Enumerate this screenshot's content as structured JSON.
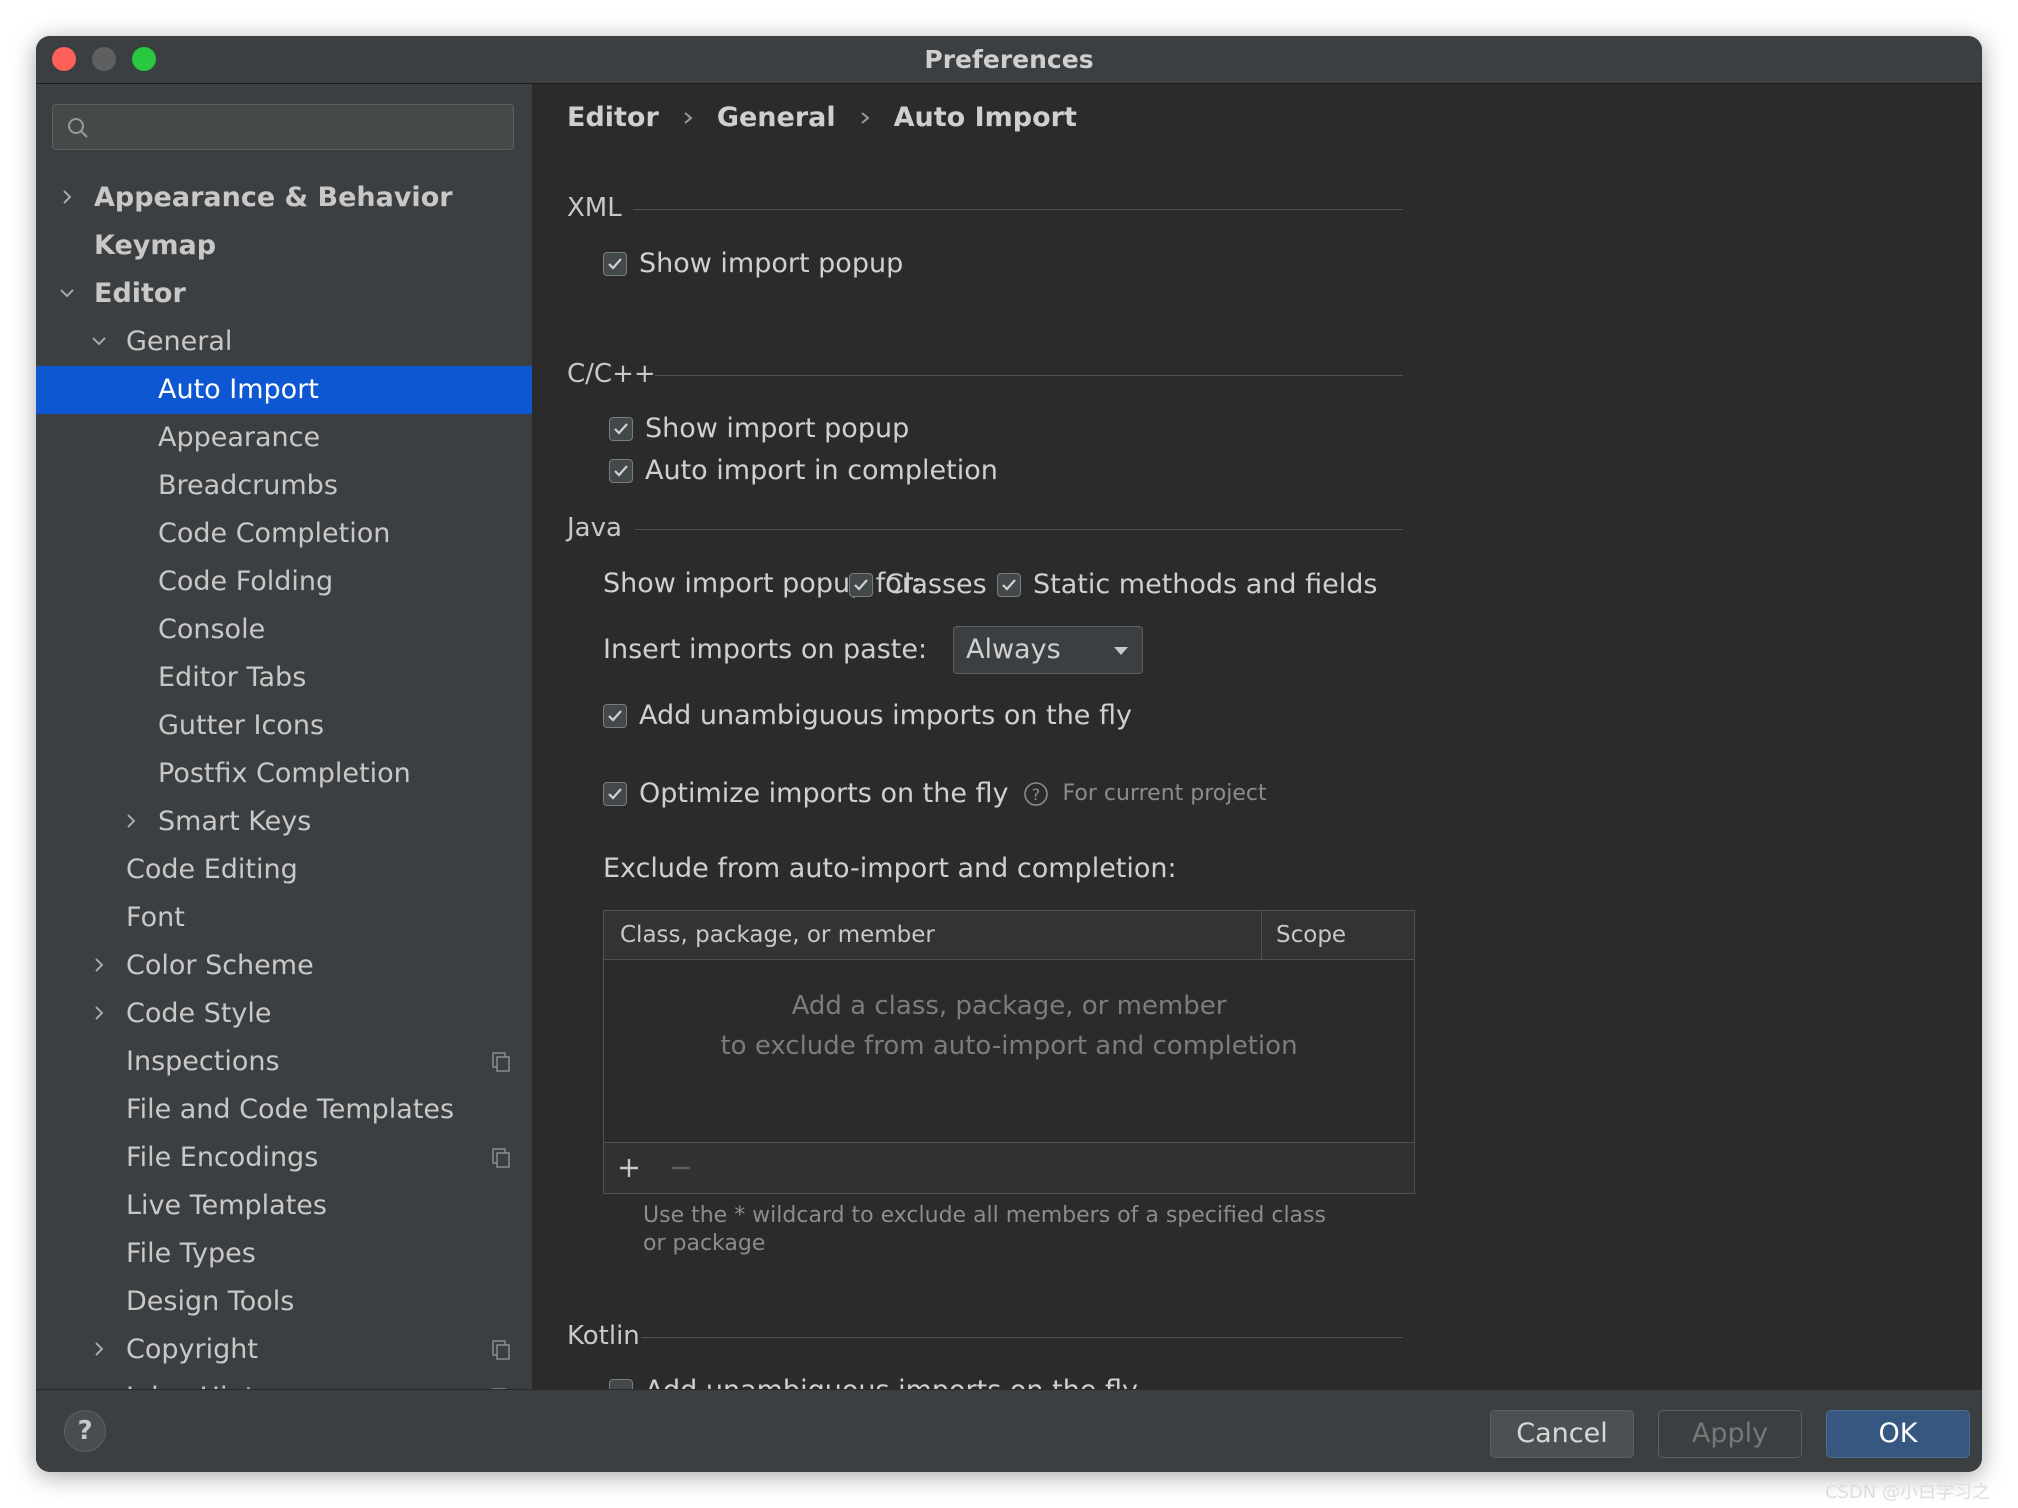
{
  "window": {
    "title": "Preferences"
  },
  "sidebar": {
    "search": {
      "placeholder": "",
      "value": ""
    },
    "items": [
      {
        "label": "Appearance & Behavior",
        "level": 0,
        "bold": true,
        "expandable": true,
        "expanded": false
      },
      {
        "label": "Keymap",
        "level": 0,
        "bold": true
      },
      {
        "label": "Editor",
        "level": 0,
        "bold": true,
        "expandable": true,
        "expanded": true
      },
      {
        "label": "General",
        "level": 1,
        "expandable": true,
        "expanded": true
      },
      {
        "label": "Auto Import",
        "level": 2,
        "selected": true
      },
      {
        "label": "Appearance",
        "level": 2
      },
      {
        "label": "Breadcrumbs",
        "level": 2
      },
      {
        "label": "Code Completion",
        "level": 2
      },
      {
        "label": "Code Folding",
        "level": 2
      },
      {
        "label": "Console",
        "level": 2
      },
      {
        "label": "Editor Tabs",
        "level": 2
      },
      {
        "label": "Gutter Icons",
        "level": 2
      },
      {
        "label": "Postfix Completion",
        "level": 2
      },
      {
        "label": "Smart Keys",
        "level": 2,
        "expandable": true,
        "expanded": false
      },
      {
        "label": "Code Editing",
        "level": 1
      },
      {
        "label": "Font",
        "level": 1
      },
      {
        "label": "Color Scheme",
        "level": 1,
        "expandable": true,
        "expanded": false
      },
      {
        "label": "Code Style",
        "level": 1,
        "expandable": true,
        "expanded": false
      },
      {
        "label": "Inspections",
        "level": 1,
        "project_icon": true
      },
      {
        "label": "File and Code Templates",
        "level": 1
      },
      {
        "label": "File Encodings",
        "level": 1,
        "project_icon": true
      },
      {
        "label": "Live Templates",
        "level": 1
      },
      {
        "label": "File Types",
        "level": 1
      },
      {
        "label": "Design Tools",
        "level": 1
      },
      {
        "label": "Copyright",
        "level": 1,
        "expandable": true,
        "expanded": false,
        "project_icon": true
      },
      {
        "label": "Inlay Hints",
        "level": 1,
        "expandable": true,
        "expanded": false,
        "project_icon": true
      }
    ]
  },
  "breadcrumb": [
    "Editor",
    "General",
    "Auto Import"
  ],
  "xml": {
    "title": "XML",
    "show_import_popup": {
      "label": "Show import popup",
      "checked": true
    }
  },
  "cpp": {
    "title": "C/C++",
    "show_import_popup": {
      "label": "Show import popup",
      "checked": true
    },
    "auto_import_completion": {
      "label": "Auto import in completion",
      "checked": true
    }
  },
  "java": {
    "title": "Java",
    "popup_for_label": "Show import popup for:",
    "classes": {
      "label": "Classes",
      "checked": true
    },
    "static_methods": {
      "label": "Static methods and fields",
      "checked": true
    },
    "insert_on_paste_label": "Insert imports on paste:",
    "insert_on_paste_value": "Always",
    "add_unambiguous": {
      "label": "Add unambiguous imports on the fly",
      "checked": true
    },
    "optimize": {
      "label": "Optimize imports on the fly",
      "checked": true,
      "hint": "For current project"
    },
    "exclude_label": "Exclude from auto-import and completion:",
    "table": {
      "columns": [
        "Class, package, or member",
        "Scope"
      ],
      "empty_line1": "Add a class, package, or member",
      "empty_line2": "to exclude from auto-import and completion"
    },
    "wildcard_note": "Use the * wildcard to exclude all members of a specified class or package"
  },
  "kotlin": {
    "title": "Kotlin",
    "add_unambiguous": {
      "label": "Add unambiguous imports on the fly",
      "checked": false
    }
  },
  "buttons": {
    "help": "?",
    "cancel": "Cancel",
    "apply": "Apply",
    "ok": "OK"
  },
  "colors": {
    "selection": "#0d58d2",
    "ok_button": "#365880",
    "panel": "#3c3f41",
    "content": "#2b2b2b"
  },
  "watermark": "CSDN @小白学习之"
}
